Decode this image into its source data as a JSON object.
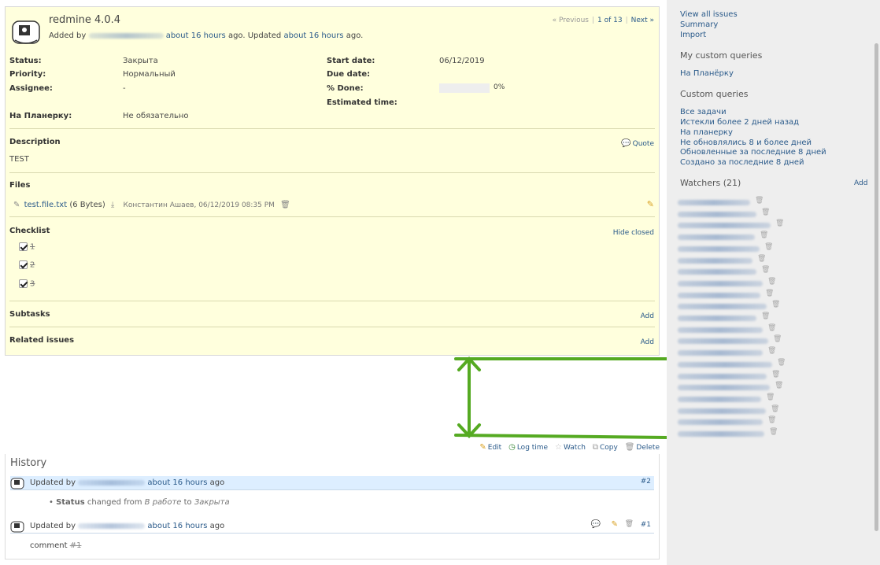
{
  "issue": {
    "title": "redmine 4.0.4",
    "added_by": "Added by",
    "added_ago": "about 16 hours",
    "ago_text": "ago. Updated",
    "updated_ago": "about 16 hours",
    "ago_end": "ago.",
    "nav": {
      "previous": "« Previous",
      "position": "1 of 13",
      "next": "Next »"
    }
  },
  "attributes": {
    "status_label": "Status:",
    "status_value": "Закрыта",
    "priority_label": "Priority:",
    "priority_value": "Нормальный",
    "assignee_label": "Assignee:",
    "assignee_value": "-",
    "start_label": "Start date:",
    "start_value": "06/12/2019",
    "due_label": "Due date:",
    "done_label": "% Done:",
    "done_value": "0%",
    "done_fraction": 0,
    "estimated_label": "Estimated time:",
    "custom_label": "На Планерку:",
    "custom_value": "Не обязательно"
  },
  "description": {
    "title": "Description",
    "quote": "Quote",
    "text": "TEST"
  },
  "files": {
    "title": "Files",
    "name": "test.file.txt",
    "size": "(6 Bytes)",
    "author": "Константин Ашаев, 06/12/2019 08:35 PM"
  },
  "checklist": {
    "title": "Checklist",
    "hide_closed": "Hide closed",
    "items": [
      "1",
      "2",
      "3"
    ]
  },
  "subtasks": {
    "title": "Subtasks",
    "add": "Add"
  },
  "related": {
    "title": "Related issues",
    "add": "Add"
  },
  "actions": {
    "edit": "Edit",
    "log_time": "Log time",
    "watch": "Watch",
    "copy": "Copy",
    "delete": "Delete"
  },
  "history": {
    "title": "History",
    "j1_updated_by": "Updated by",
    "j1_ago": "about 16 hours",
    "j1_ago_tail": "ago",
    "j1_num": "#2",
    "j1_detail_field": "Status",
    "j1_detail_changed": "changed from",
    "j1_detail_from": "В работе",
    "j1_detail_to_word": "to",
    "j1_detail_to": "Закрыта",
    "j2_updated_by": "Updated by",
    "j2_ago": "about 16 hours",
    "j2_ago_tail": "ago",
    "j2_num": "#1",
    "j2_comment": "comment",
    "j2_comment_ref": "#1"
  },
  "sidebar": {
    "view_all": "View all issues",
    "summary": "Summary",
    "import": "Import",
    "my_queries_title": "My custom queries",
    "my_query_1": "На Планёрку",
    "custom_queries_title": "Custom queries",
    "queries": [
      "Все задачи",
      "Истекли более 2 дней назад",
      "На планерку",
      "Не обновлялись 8 и более дней",
      "Обновленные за последние 8 дней",
      "Создано за последние 8 дней"
    ],
    "watchers_title": "Watchers (21)",
    "watchers_add": "Add"
  },
  "colors": {
    "accent_link": "#2a5a8a",
    "issue_bg": "#ffffdd",
    "annotation_green": "#55aa22"
  }
}
